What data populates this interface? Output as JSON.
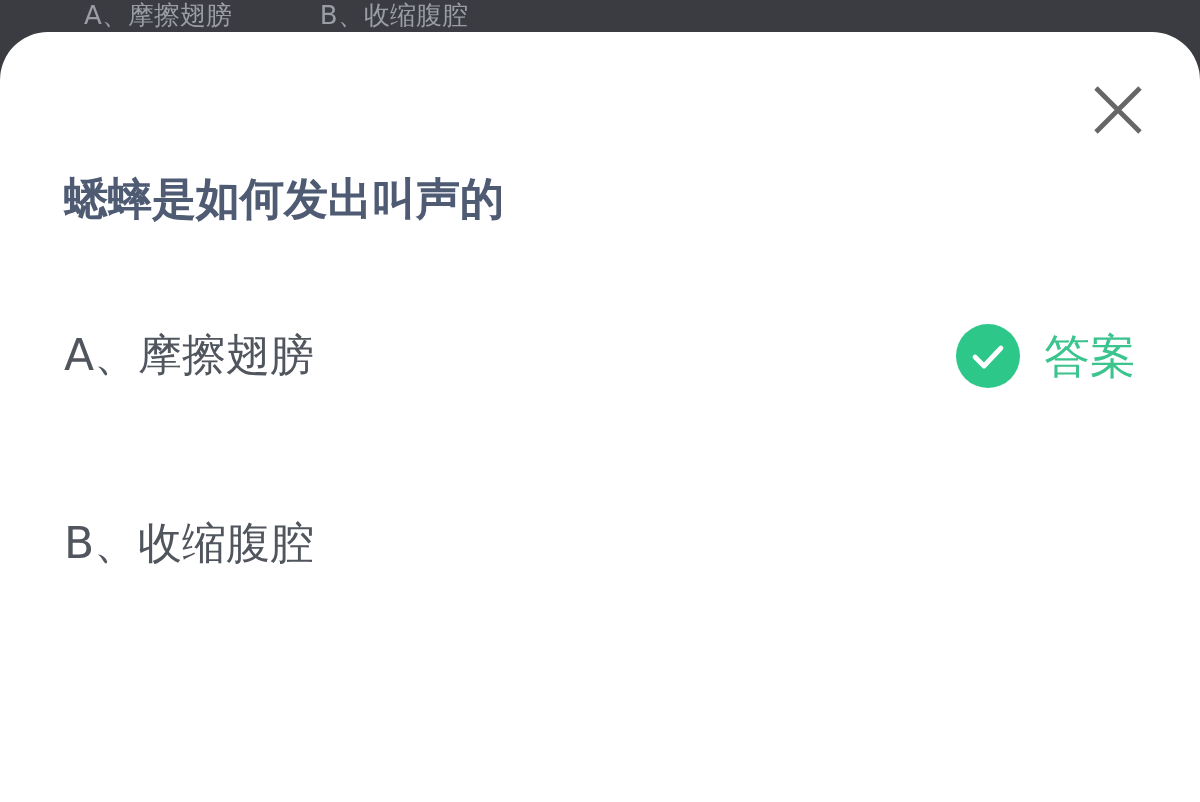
{
  "background_options": [
    "A、摩擦翅膀",
    "B、收缩腹腔"
  ],
  "question": "蟋蟀是如何发出叫声的",
  "options": [
    {
      "label": "A、摩擦翅膀",
      "correct": true,
      "answer_label": "答案"
    },
    {
      "label": "B、收缩腹腔",
      "correct": false
    }
  ]
}
